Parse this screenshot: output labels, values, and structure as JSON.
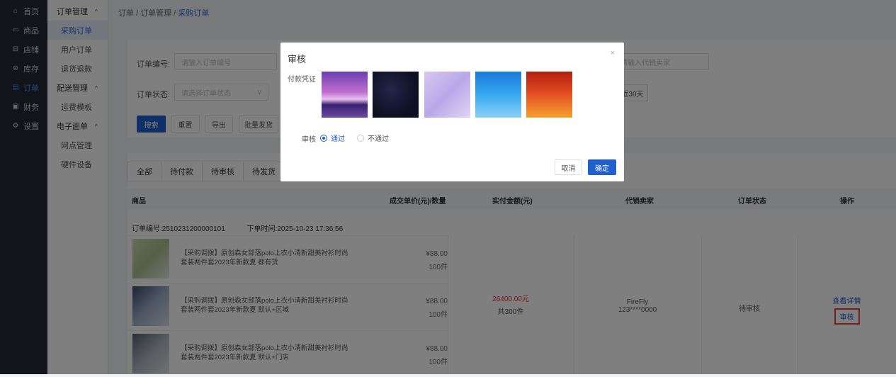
{
  "sidebar": {
    "items": [
      {
        "label": "首页",
        "icon": "home-icon",
        "glyph": "⌂"
      },
      {
        "label": "商品",
        "icon": "goods-icon",
        "glyph": "▭"
      },
      {
        "label": "店铺",
        "icon": "shop-icon",
        "glyph": "⊟"
      },
      {
        "label": "库存",
        "icon": "inventory-icon",
        "glyph": "⊜"
      },
      {
        "label": "订单",
        "icon": "order-icon",
        "glyph": "▤"
      },
      {
        "label": "财务",
        "icon": "finance-icon",
        "glyph": "▣"
      },
      {
        "label": "设置",
        "icon": "settings-icon",
        "glyph": "⚙"
      }
    ]
  },
  "subnav": {
    "group1": "订单管理",
    "item1": "采购订单",
    "item2": "用户订单",
    "item3": "退货退款",
    "group2": "配送管理",
    "item4": "运费模板",
    "group3": "电子面单",
    "item5": "网点管理",
    "item6": "硬件设备"
  },
  "breadcrumb": {
    "a": "订单",
    "sep": "/",
    "b": "订单管理",
    "c": "采购订单"
  },
  "search": {
    "order_no_label": "订单编号:",
    "order_no_placeholder": "请输入订单编号",
    "seller_placeholder": "请输入代销卖家",
    "status_label": "订单状态:",
    "status_placeholder": "请选择订单状态",
    "last30": "近30天",
    "btn_search": "搜索",
    "btn_reset": "重置",
    "btn_export": "导出",
    "btn_batch": "批量发货"
  },
  "tabs": [
    "全部",
    "待付款",
    "待审核",
    "待发货"
  ],
  "table": {
    "headers": {
      "product": "商品",
      "price": "成交单价(元)/数量",
      "paid": "实付金额(元)",
      "seller": "代销卖家",
      "status": "订单状态",
      "op": "操作"
    },
    "order_no": "订单编号:2510231200000101",
    "order_time": "下单时间:2025-10-23 17:36:56",
    "rows": [
      {
        "title": "【采购调拨】原创森女部落polo上衣小清新甜美衬衫时尚套装两件套2023年新款夏 都有货",
        "price": "¥88.00",
        "qty": "100件"
      },
      {
        "title": "【采购调拨】原创森女部落polo上衣小清新甜美衬衫时尚套装两件套2023年新款夏 默认+区域",
        "price": "¥88.00",
        "qty": "100件"
      },
      {
        "title": "【采购调拨】原创森女部落polo上衣小清新甜美衬衫时尚套装两件套2023年新款夏 默认+门店",
        "price": "¥88.00",
        "qty": "100件"
      }
    ],
    "paid_amount": "26400.00元",
    "paid_count": "共300件",
    "seller_name": "FireFly",
    "seller_phone": "123****0000",
    "status_text": "待审核",
    "op_detail": "查看详情",
    "op_review": "审核"
  },
  "modal": {
    "title": "审核",
    "close": "×",
    "proof_label": "付款凭证",
    "review_label": "审核",
    "opt_pass": "通过",
    "opt_fail": "不通过",
    "cancel": "取消",
    "confirm": "确定"
  },
  "colors": {
    "accent": "#1f5fd0",
    "price_red": "#e03030",
    "highlight": "#e04040"
  }
}
